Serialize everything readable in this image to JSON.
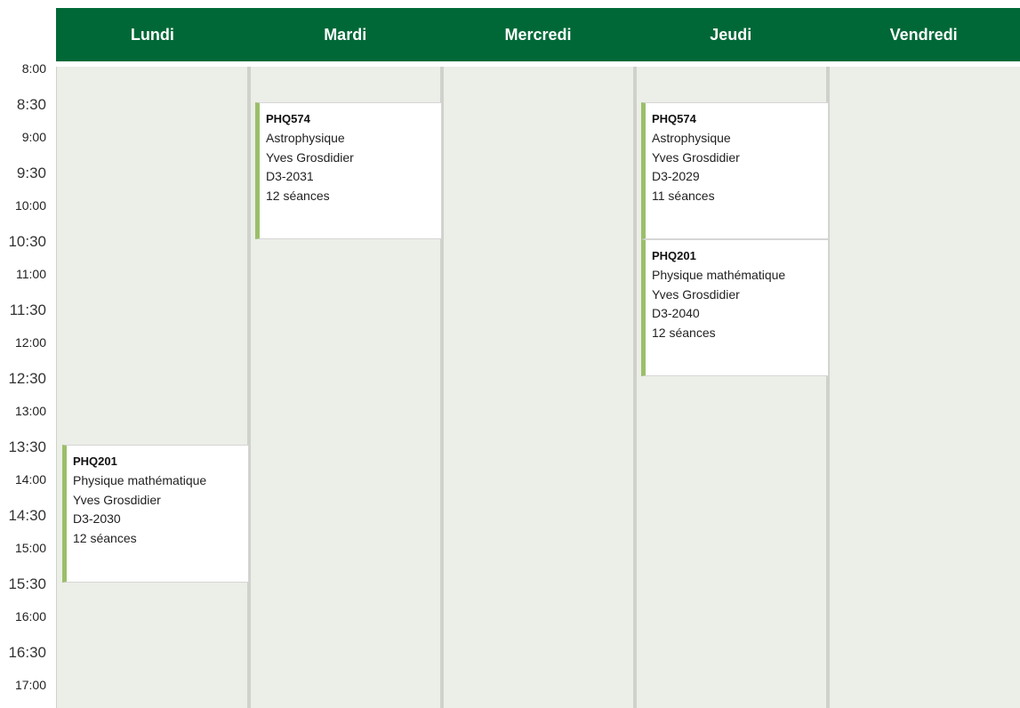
{
  "days": [
    "Lundi",
    "Mardi",
    "Mercredi",
    "Jeudi",
    "Vendredi"
  ],
  "times": [
    "8:00",
    "8:30",
    "9:00",
    "9:30",
    "10:00",
    "10:30",
    "11:00",
    "11:30",
    "12:00",
    "12:30",
    "13:00",
    "13:30",
    "14:00",
    "14:30",
    "15:00",
    "15:30",
    "16:00",
    "16:30",
    "17:00"
  ],
  "events": [
    {
      "code": "PHQ201",
      "title": "Physique mathématique",
      "teacher": "Yves Grosdidier",
      "room": "D3-2030",
      "sessions": "12 séances"
    },
    {
      "code": "PHQ574",
      "title": "Astrophysique",
      "teacher": "Yves Grosdidier",
      "room": "D3-2031",
      "sessions": "12 séances"
    },
    {
      "code": "PHQ574",
      "title": "Astrophysique",
      "teacher": "Yves Grosdidier",
      "room": "D3-2029",
      "sessions": "11 séances"
    },
    {
      "code": "PHQ201",
      "title": "Physique mathématique",
      "teacher": "Yves Grosdidier",
      "room": "D3-2040",
      "sessions": "12 séances"
    }
  ],
  "colors": {
    "header_bg": "#006837",
    "header_text": "#ffffff",
    "column_bg": "#eceee8",
    "event_accent": "#9bbf6a",
    "event_bg": "#ffffff"
  }
}
